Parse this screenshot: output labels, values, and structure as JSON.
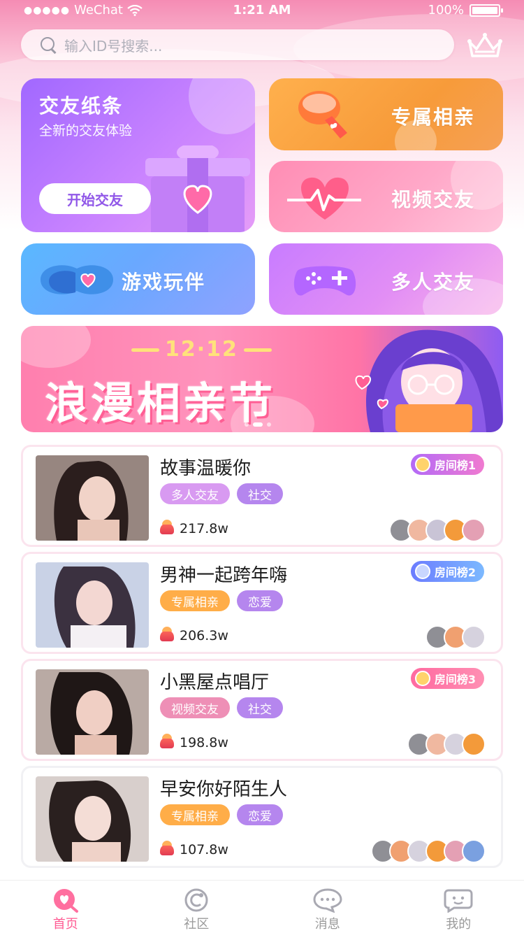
{
  "status_bar": {
    "carrier": "WeChat",
    "time": "1:21 AM",
    "battery": "100%",
    "battery_level": 1.0
  },
  "search": {
    "placeholder": "输入ID号搜索..."
  },
  "feature_tiles": {
    "main": {
      "title": "交友纸条",
      "subtitle": "全新的交友体验",
      "button": "开始交友"
    },
    "items": [
      {
        "label": "专属相亲",
        "icon": "microphone-icon"
      },
      {
        "label": "视频交友",
        "icon": "heartbeat-icon"
      },
      {
        "label": "游戏玩伴",
        "icon": "chat-bubble-icon"
      },
      {
        "label": "多人交友",
        "icon": "gamepad-icon"
      }
    ]
  },
  "banner": {
    "date": "12·12",
    "title": "浪漫相亲节"
  },
  "rooms": [
    {
      "name": "故事温暖你",
      "tags": [
        "多人交友",
        "社交"
      ],
      "heat": "217.8w",
      "rank": "房间榜1"
    },
    {
      "name": "男神一起跨年嗨",
      "tags": [
        "专属相亲",
        "恋爱"
      ],
      "heat": "206.3w",
      "rank": "房间榜2"
    },
    {
      "name": "小黑屋点唱厅",
      "tags": [
        "视频交友",
        "社交"
      ],
      "heat": "198.8w",
      "rank": "房间榜3"
    },
    {
      "name": "早安你好陌生人",
      "tags": [
        "专属相亲",
        "恋爱"
      ],
      "heat": "107.8w",
      "rank": ""
    }
  ],
  "tabbar": {
    "items": [
      {
        "label": "首页",
        "icon": "home-heart-icon"
      },
      {
        "label": "社区",
        "icon": "community-icon"
      },
      {
        "label": "消息",
        "icon": "message-icon"
      },
      {
        "label": "我的",
        "icon": "profile-icon"
      }
    ]
  },
  "colors": {
    "accent": "#ff5b93",
    "purple": "#a168ff",
    "orange": "#f79b3a"
  }
}
